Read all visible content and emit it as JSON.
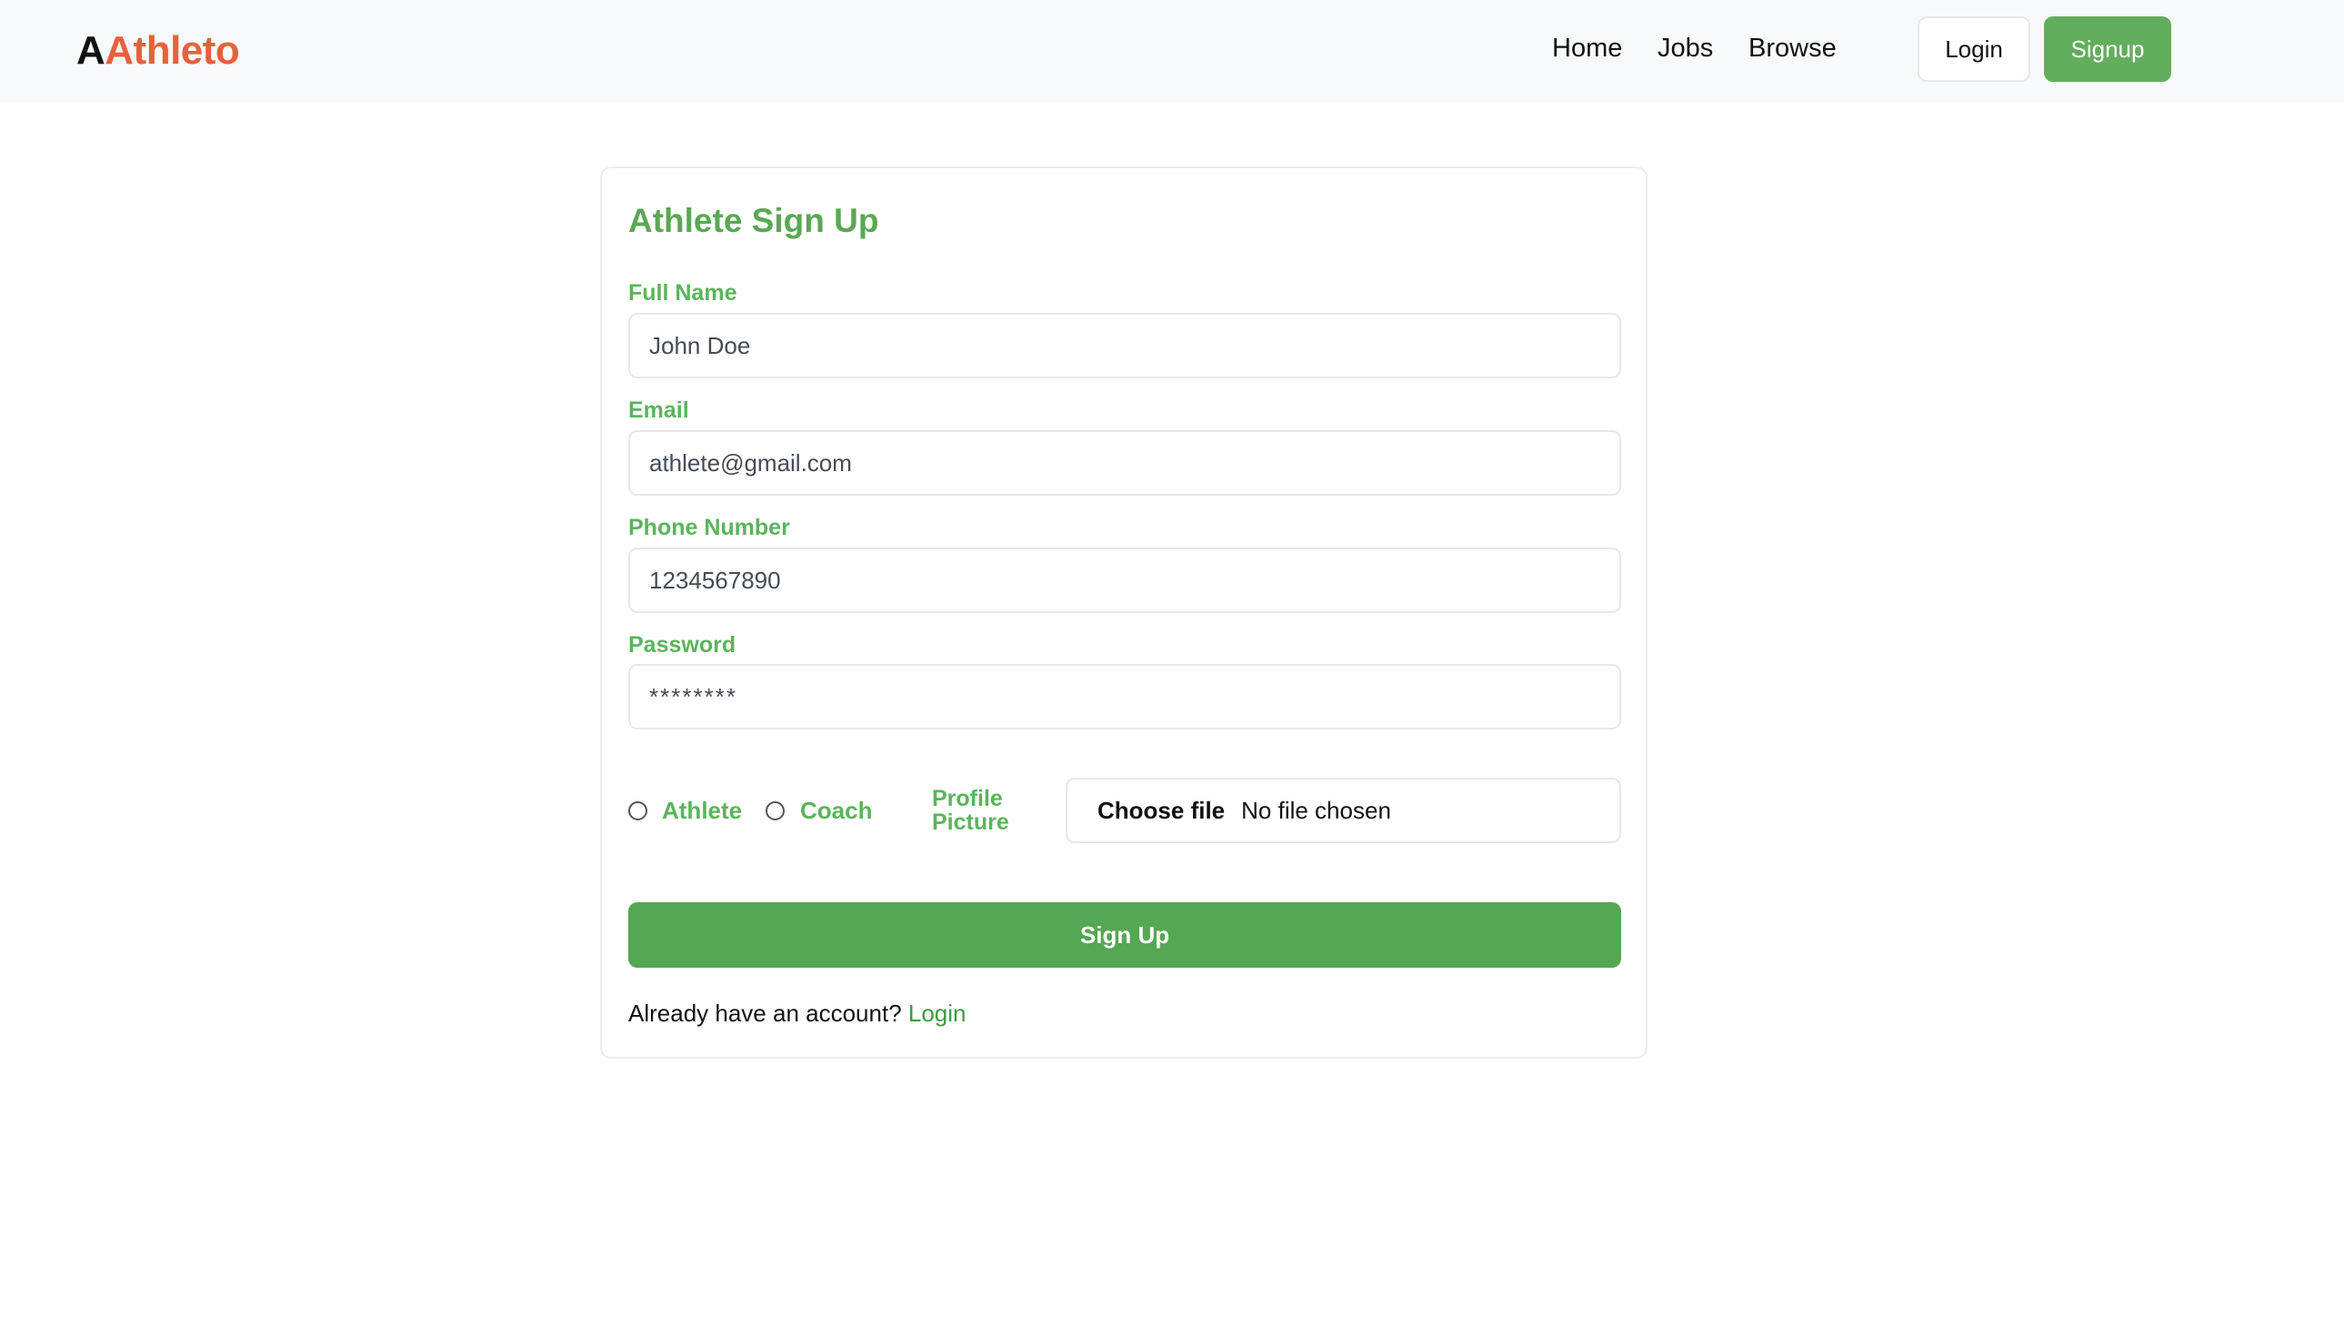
{
  "header": {
    "logo_prefix": "A",
    "logo_name": "Athleto",
    "nav": {
      "home": "Home",
      "jobs": "Jobs",
      "browse": "Browse"
    },
    "login_label": "Login",
    "signup_label": "Signup"
  },
  "form": {
    "title": "Athlete Sign Up",
    "full_name": {
      "label": "Full Name",
      "placeholder": "John Doe"
    },
    "email": {
      "label": "Email",
      "placeholder": "athlete@gmail.com"
    },
    "phone": {
      "label": "Phone Number",
      "placeholder": "1234567890"
    },
    "password": {
      "label": "Password",
      "placeholder": "********"
    },
    "roles": {
      "athlete": "Athlete",
      "coach": "Coach"
    },
    "profile_picture_label": "Profile Picture",
    "file_input": {
      "button": "Choose file",
      "status": "No file chosen"
    },
    "submit_label": "Sign Up",
    "footer_text": "Already have an account?",
    "footer_link": "Login"
  },
  "colors": {
    "accent_green": "#55a753",
    "label_green": "#5ab55a",
    "logo_orange": "#e8603c",
    "header_bg": "#f8f9fa"
  }
}
